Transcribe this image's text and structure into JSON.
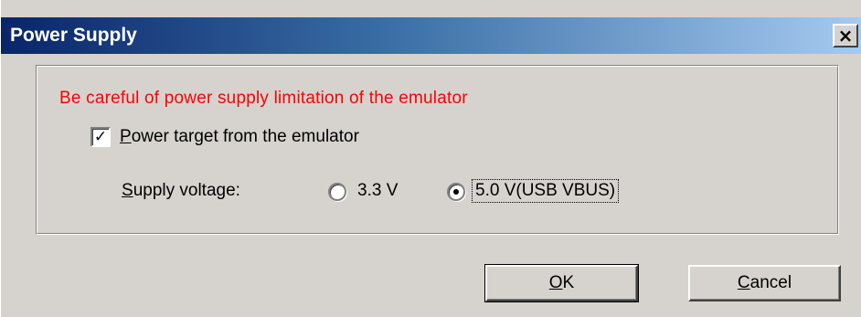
{
  "window": {
    "title": "Power Supply",
    "close_label": "×"
  },
  "warning_text": "Be careful of power supply limitation of the emulator",
  "power_target": {
    "mnemonic": "P",
    "label_rest": "ower target from the emulator",
    "checked": true
  },
  "supply_voltage": {
    "mnemonic": "S",
    "label_rest": "upply voltage:",
    "options": [
      {
        "label": "3.3 V",
        "selected": false
      },
      {
        "label": "5.0 V(USB VBUS)",
        "selected": true
      }
    ]
  },
  "buttons": {
    "ok_mnemonic": "O",
    "ok_rest": "K",
    "cancel_mnemonic": "C",
    "cancel_rest": "ancel"
  },
  "colors": {
    "warning": "#ff0000",
    "titlebar_start": "#0a246a",
    "titlebar_end": "#a6caf0",
    "dialog_bg": "#d6d3ce"
  }
}
